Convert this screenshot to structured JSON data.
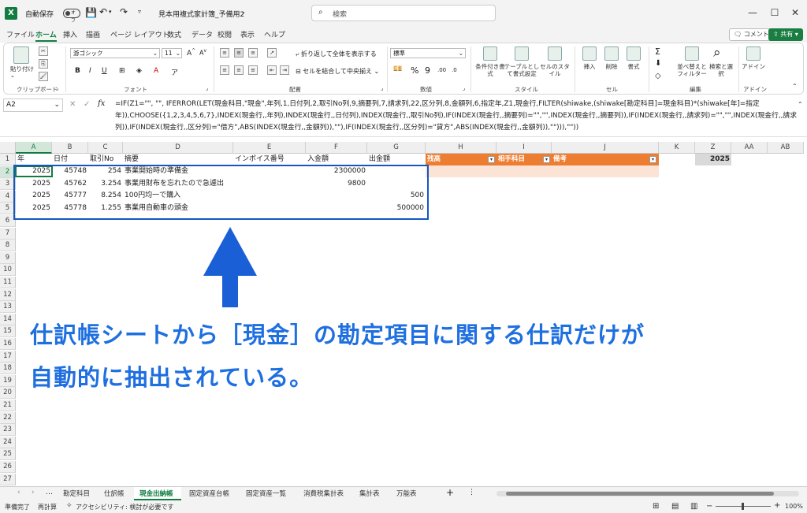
{
  "titlebar": {
    "autosave_label": "自動保存",
    "autosave_state": "オフ",
    "doc_title": "見本用複式家計簿_予備用2",
    "search_placeholder": "検索"
  },
  "menu": {
    "tabs": [
      "ファイル",
      "ホーム",
      "挿入",
      "描画",
      "ページ レイアウト",
      "数式",
      "データ",
      "校閲",
      "表示",
      "ヘルプ"
    ],
    "active": "ホーム",
    "comment_label": "コメント",
    "share_label": "共有"
  },
  "ribbon": {
    "paste_label": "貼り付け",
    "clipboard_label": "クリップボード",
    "font_name": "游ゴシック",
    "font_size": "11",
    "font_group_label": "フォント",
    "wrap_label": "折り返して全体を表示する",
    "merge_label": "セルを結合して中央揃え",
    "align_group_label": "配置",
    "number_format": "標準",
    "number_group_label": "数値",
    "cond_format_label": "条件付き書式",
    "table_format_label": "テーブルとして書式設定",
    "cell_style_label": "セルのスタイル",
    "style_group_label": "スタイル",
    "insert_label": "挿入",
    "delete_label": "削除",
    "format_label": "書式",
    "cell_group_label": "セル",
    "sort_label": "並べ替えとフィルター",
    "find_label": "検索と選択",
    "edit_group_label": "編集",
    "addin_label": "アドイン",
    "addin_group_label": "アドイン"
  },
  "formula_bar": {
    "name_box": "A2",
    "fx": "fx",
    "formula": "=IF(Z1=\"\", \"\", IFERROR(LET(現金科目,\"現金\",年列,1,日付列,2,取引No列,9,摘要列,7,請求列,22,区分列,8,金額列,6,指定年,Z1,現金行,FILTER(shiwake,(shiwake[勘定科目]=現金科目)*(shiwake[年]=指定年)),CHOOSE({1,2,3,4,5,6,7},INDEX(現金行,,年列),INDEX(現金行,,日付列),INDEX(現金行,,取引No列),IF(INDEX(現金行,,摘要列)=\"\",\"\",INDEX(現金行,,摘要列)),IF(INDEX(現金行,,請求列)=\"\",\"\",INDEX(現金行,,請求列)),IF(INDEX(現金行,,区分列)=\"借方\",ABS(INDEX(現金行,,金額列)),\"\"),IF(INDEX(現金行,,区分列)=\"貸方\",ABS(INDEX(現金行,,金額列)),\"\"))),\"\"))"
  },
  "grid": {
    "columns": [
      "A",
      "B",
      "C",
      "D",
      "E",
      "F",
      "G",
      "H",
      "I",
      "J",
      "K",
      "Z",
      "AA",
      "AB"
    ],
    "rows": [
      "1",
      "2",
      "3",
      "4",
      "5",
      "6",
      "7",
      "8",
      "9",
      "10",
      "11",
      "12",
      "13",
      "14",
      "15",
      "16",
      "17",
      "18",
      "19",
      "20",
      "21",
      "22",
      "23",
      "24",
      "25",
      "26",
      "27"
    ],
    "headers": {
      "a": "年",
      "b": "日付",
      "c": "取引No",
      "d": "摘要",
      "e": "インボイス番号",
      "f": "入金額",
      "g": "出金額",
      "h": "残高",
      "i": "相手科目",
      "j": "備考",
      "z": "2025"
    },
    "data": [
      {
        "year": "2025",
        "date": "45748",
        "no": "254",
        "desc": "事業開始時の準備金",
        "inv": "",
        "in": "2300000",
        "out": ""
      },
      {
        "year": "2025",
        "date": "45762",
        "no": "3.254",
        "desc": "事業用財布を忘れたので急遽出",
        "inv": "",
        "in": "9800",
        "out": ""
      },
      {
        "year": "2025",
        "date": "45777",
        "no": "8.254",
        "desc": "100円均一で購入",
        "inv": "",
        "in": "",
        "out": "500"
      },
      {
        "year": "2025",
        "date": "45778",
        "no": "1.255",
        "desc": "事業用自動車の頭金",
        "inv": "",
        "in": "",
        "out": "500000"
      }
    ]
  },
  "annotation": {
    "line1": "仕訳帳シートから［現金］の勘定項目に関する仕訳だけが",
    "line2": "自動的に抽出されている。"
  },
  "sheets": {
    "tabs": [
      "勘定科目",
      "仕訳帳",
      "現金出納帳",
      "固定資産台帳",
      "固定資産一覧",
      "消費税集計表",
      "集計表",
      "万能表"
    ],
    "active": "現金出納帳",
    "add_label": "+"
  },
  "status": {
    "ready": "準備完了",
    "recalc": "再計算",
    "accessibility": "アクセシビリティ: 検討が必要です",
    "zoom": "100%"
  }
}
